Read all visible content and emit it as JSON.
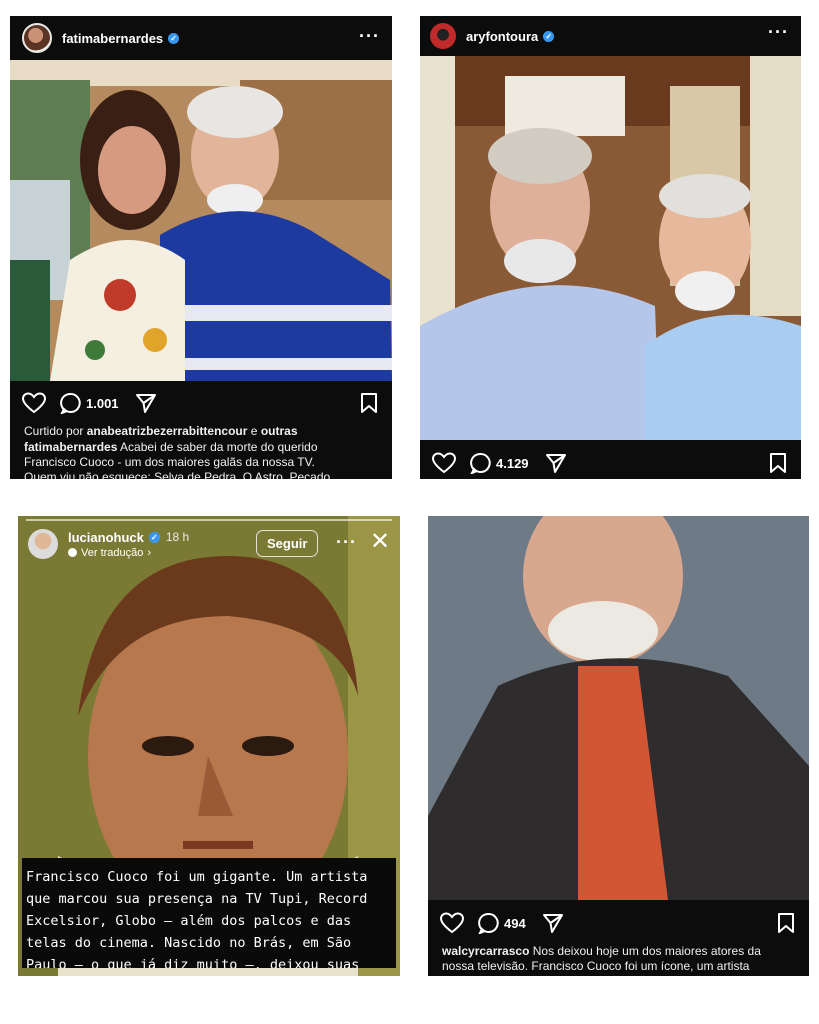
{
  "post1": {
    "username": "fatimabernardes",
    "comments_count": "1.001",
    "liked_by_prefix": "Curtido por",
    "liked_by_user": "anabeatrizbezerrabittencour",
    "liked_by_suffix": "e",
    "liked_by_others": "outras",
    "caption_user": "fatimabernardes",
    "caption_line1": "Acabei de saber da morte do querido",
    "caption_line2": "Francisco Cuoco - um dos maiores galãs da nossa TV.",
    "caption_line3": "Quem viu não esquece: Selva de Pedra, O Astro, Pecado"
  },
  "post2": {
    "username": "aryfontoura",
    "comments_count": "4.129"
  },
  "story": {
    "username": "lucianohuck",
    "time": "18 h",
    "translate_label": "Ver tradução",
    "follow_label": "Seguir",
    "text_lines": [
      "Francisco Cuoco foi um gigante. Um artista",
      "que marcou sua presença na TV Tupi, Record",
      "Excelsior, Globo — além dos palcos e das",
      "telas do cinema. Nascido no Brás, em São",
      "Paulo — o que já diz muito —, deixou suas"
    ]
  },
  "post4": {
    "comments_count": "494",
    "caption_user": "walcyrcarrasco",
    "caption_line1": "Nos deixou hoje um dos maiores atores da",
    "caption_line2": "nossa televisão. Francisco Cuoco foi um ícone, um artista"
  },
  "colors": {
    "dark_bg": "#0c0c0c",
    "verified_blue": "#3897f0",
    "story_bg": "#6e6a2e"
  },
  "icons": [
    "heart-icon",
    "comment-icon",
    "share-icon",
    "bookmark-icon",
    "verified-icon",
    "more-icon",
    "close-icon",
    "translate-icon"
  ]
}
